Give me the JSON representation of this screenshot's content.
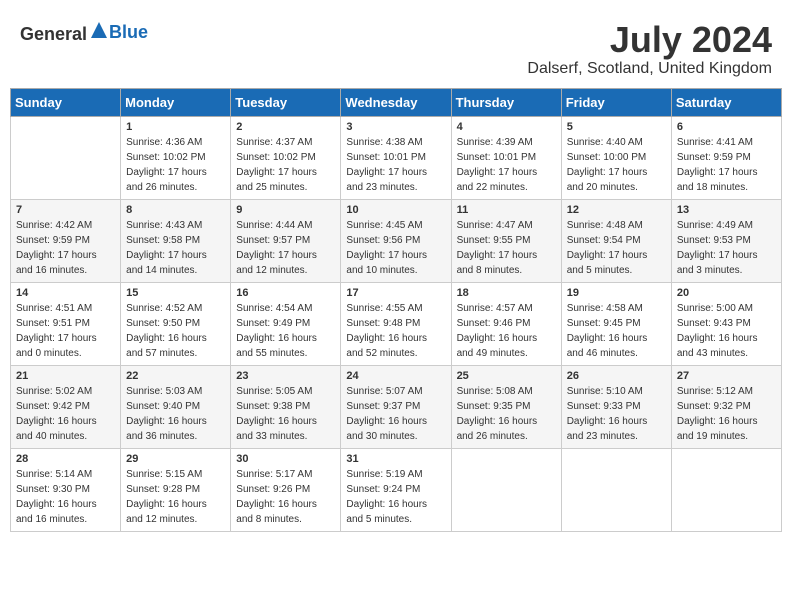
{
  "header": {
    "logo_general": "General",
    "logo_blue": "Blue",
    "month": "July 2024",
    "location": "Dalserf, Scotland, United Kingdom"
  },
  "weekdays": [
    "Sunday",
    "Monday",
    "Tuesday",
    "Wednesday",
    "Thursday",
    "Friday",
    "Saturday"
  ],
  "weeks": [
    [
      {
        "day": "",
        "info": ""
      },
      {
        "day": "1",
        "info": "Sunrise: 4:36 AM\nSunset: 10:02 PM\nDaylight: 17 hours\nand 26 minutes."
      },
      {
        "day": "2",
        "info": "Sunrise: 4:37 AM\nSunset: 10:02 PM\nDaylight: 17 hours\nand 25 minutes."
      },
      {
        "day": "3",
        "info": "Sunrise: 4:38 AM\nSunset: 10:01 PM\nDaylight: 17 hours\nand 23 minutes."
      },
      {
        "day": "4",
        "info": "Sunrise: 4:39 AM\nSunset: 10:01 PM\nDaylight: 17 hours\nand 22 minutes."
      },
      {
        "day": "5",
        "info": "Sunrise: 4:40 AM\nSunset: 10:00 PM\nDaylight: 17 hours\nand 20 minutes."
      },
      {
        "day": "6",
        "info": "Sunrise: 4:41 AM\nSunset: 9:59 PM\nDaylight: 17 hours\nand 18 minutes."
      }
    ],
    [
      {
        "day": "7",
        "info": "Sunrise: 4:42 AM\nSunset: 9:59 PM\nDaylight: 17 hours\nand 16 minutes."
      },
      {
        "day": "8",
        "info": "Sunrise: 4:43 AM\nSunset: 9:58 PM\nDaylight: 17 hours\nand 14 minutes."
      },
      {
        "day": "9",
        "info": "Sunrise: 4:44 AM\nSunset: 9:57 PM\nDaylight: 17 hours\nand 12 minutes."
      },
      {
        "day": "10",
        "info": "Sunrise: 4:45 AM\nSunset: 9:56 PM\nDaylight: 17 hours\nand 10 minutes."
      },
      {
        "day": "11",
        "info": "Sunrise: 4:47 AM\nSunset: 9:55 PM\nDaylight: 17 hours\nand 8 minutes."
      },
      {
        "day": "12",
        "info": "Sunrise: 4:48 AM\nSunset: 9:54 PM\nDaylight: 17 hours\nand 5 minutes."
      },
      {
        "day": "13",
        "info": "Sunrise: 4:49 AM\nSunset: 9:53 PM\nDaylight: 17 hours\nand 3 minutes."
      }
    ],
    [
      {
        "day": "14",
        "info": "Sunrise: 4:51 AM\nSunset: 9:51 PM\nDaylight: 17 hours\nand 0 minutes."
      },
      {
        "day": "15",
        "info": "Sunrise: 4:52 AM\nSunset: 9:50 PM\nDaylight: 16 hours\nand 57 minutes."
      },
      {
        "day": "16",
        "info": "Sunrise: 4:54 AM\nSunset: 9:49 PM\nDaylight: 16 hours\nand 55 minutes."
      },
      {
        "day": "17",
        "info": "Sunrise: 4:55 AM\nSunset: 9:48 PM\nDaylight: 16 hours\nand 52 minutes."
      },
      {
        "day": "18",
        "info": "Sunrise: 4:57 AM\nSunset: 9:46 PM\nDaylight: 16 hours\nand 49 minutes."
      },
      {
        "day": "19",
        "info": "Sunrise: 4:58 AM\nSunset: 9:45 PM\nDaylight: 16 hours\nand 46 minutes."
      },
      {
        "day": "20",
        "info": "Sunrise: 5:00 AM\nSunset: 9:43 PM\nDaylight: 16 hours\nand 43 minutes."
      }
    ],
    [
      {
        "day": "21",
        "info": "Sunrise: 5:02 AM\nSunset: 9:42 PM\nDaylight: 16 hours\nand 40 minutes."
      },
      {
        "day": "22",
        "info": "Sunrise: 5:03 AM\nSunset: 9:40 PM\nDaylight: 16 hours\nand 36 minutes."
      },
      {
        "day": "23",
        "info": "Sunrise: 5:05 AM\nSunset: 9:38 PM\nDaylight: 16 hours\nand 33 minutes."
      },
      {
        "day": "24",
        "info": "Sunrise: 5:07 AM\nSunset: 9:37 PM\nDaylight: 16 hours\nand 30 minutes."
      },
      {
        "day": "25",
        "info": "Sunrise: 5:08 AM\nSunset: 9:35 PM\nDaylight: 16 hours\nand 26 minutes."
      },
      {
        "day": "26",
        "info": "Sunrise: 5:10 AM\nSunset: 9:33 PM\nDaylight: 16 hours\nand 23 minutes."
      },
      {
        "day": "27",
        "info": "Sunrise: 5:12 AM\nSunset: 9:32 PM\nDaylight: 16 hours\nand 19 minutes."
      }
    ],
    [
      {
        "day": "28",
        "info": "Sunrise: 5:14 AM\nSunset: 9:30 PM\nDaylight: 16 hours\nand 16 minutes."
      },
      {
        "day": "29",
        "info": "Sunrise: 5:15 AM\nSunset: 9:28 PM\nDaylight: 16 hours\nand 12 minutes."
      },
      {
        "day": "30",
        "info": "Sunrise: 5:17 AM\nSunset: 9:26 PM\nDaylight: 16 hours\nand 8 minutes."
      },
      {
        "day": "31",
        "info": "Sunrise: 5:19 AM\nSunset: 9:24 PM\nDaylight: 16 hours\nand 5 minutes."
      },
      {
        "day": "",
        "info": ""
      },
      {
        "day": "",
        "info": ""
      },
      {
        "day": "",
        "info": ""
      }
    ]
  ]
}
